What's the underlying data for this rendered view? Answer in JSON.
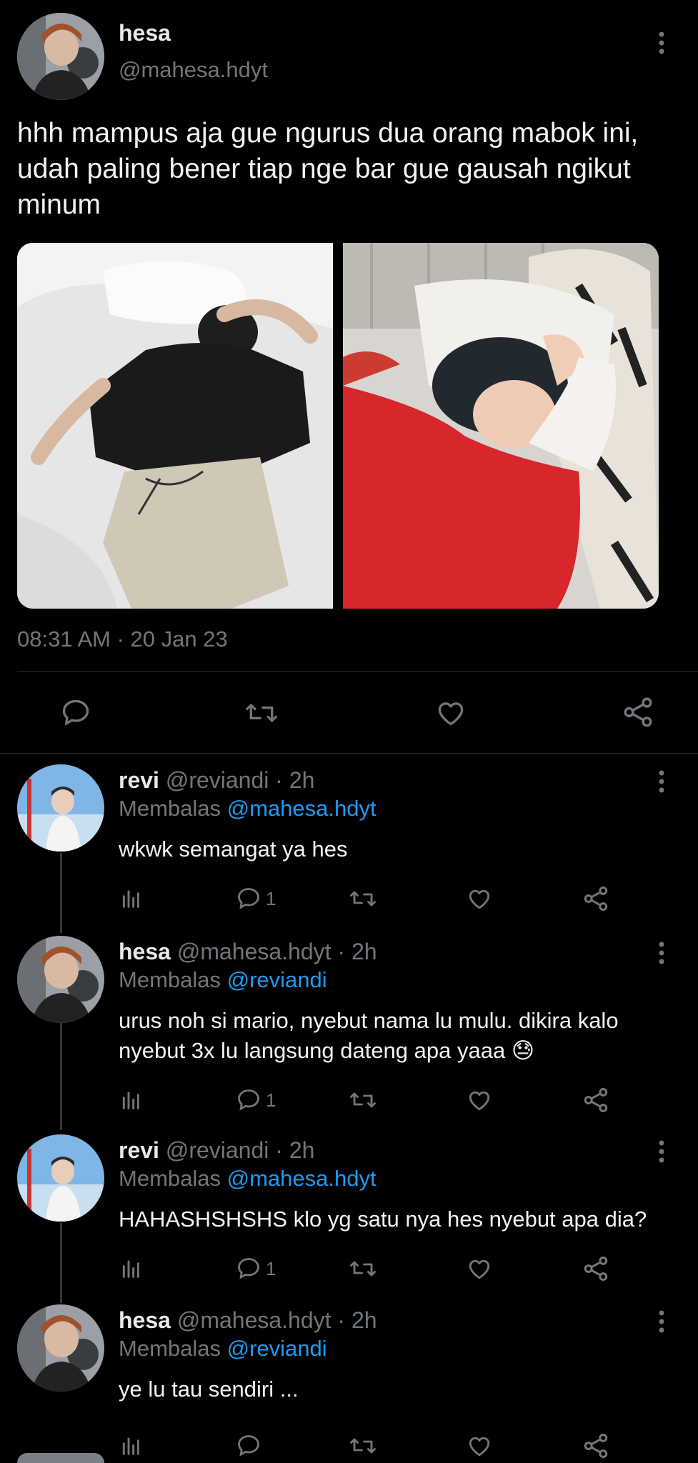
{
  "main_tweet": {
    "author_name": "hesa",
    "author_handle": "@mahesa.hdyt",
    "text": "hhh mampus aja gue ngurus dua orang mabok ini, udah paling bener tiap nge bar gue gausah ngikut minum",
    "timestamp": "08:31 AM · 20 Jan 23"
  },
  "replies": [
    {
      "name": "revi",
      "handle": "@reviandi",
      "time": "2h",
      "replying_label": "Membalas",
      "replying_to": "@mahesa.hdyt",
      "text": "wkwk semangat ya hes",
      "reply_count": "1",
      "avatar": "revi"
    },
    {
      "name": "hesa",
      "handle": "@mahesa.hdyt",
      "time": "2h",
      "replying_label": "Membalas",
      "replying_to": "@reviandi",
      "text": "urus noh si mario, nyebut nama lu mulu. dikira kalo nyebut 3x lu langsung dateng apa yaaa 😓",
      "reply_count": "1",
      "avatar": "hesa"
    },
    {
      "name": "revi",
      "handle": "@reviandi",
      "time": "2h",
      "replying_label": "Membalas",
      "replying_to": "@mahesa.hdyt",
      "text": "HAHASHSHSHS klo yg satu nya hes nyebut apa dia?",
      "reply_count": "1",
      "avatar": "revi"
    },
    {
      "name": "hesa",
      "handle": "@mahesa.hdyt",
      "time": "2h",
      "replying_label": "Membalas",
      "replying_to": "@reviandi",
      "text": "ye lu tau sendiri ...",
      "reply_count": "",
      "avatar": "hesa"
    }
  ],
  "colors": {
    "background": "#000000",
    "text": "#e7e9ea",
    "muted": "#71767b",
    "accent": "#1d9bf0",
    "divider": "#2f3336"
  }
}
